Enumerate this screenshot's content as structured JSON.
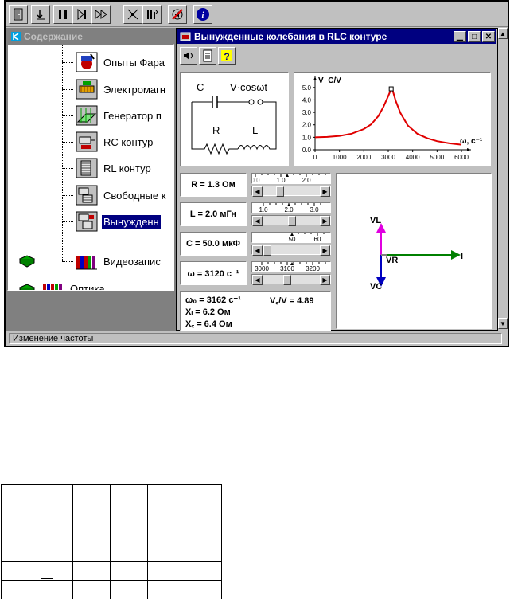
{
  "tree": {
    "title": "Содержание",
    "items": [
      {
        "label": "Опыты Фара",
        "icon": "faraday-experiments-icon"
      },
      {
        "label": "Электромагн",
        "icon": "electromagnet-icon"
      },
      {
        "label": "Генератор п",
        "icon": "generator-icon"
      },
      {
        "label": "RC контур",
        "icon": "rc-circuit-icon"
      },
      {
        "label": "RL контур",
        "icon": "rl-circuit-icon"
      },
      {
        "label": "Свободные к",
        "icon": "free-oscillations-icon"
      },
      {
        "label": "Вынужденн",
        "icon": "forced-oscillations-icon",
        "selected": true
      },
      {
        "label": "Видеозапис",
        "icon": "video-recordings-icon"
      }
    ],
    "bottom_item": {
      "label": "Оптика",
      "icon": "optics-icon"
    }
  },
  "child_window": {
    "title": "Вынужденные колебания в RLC контуре"
  },
  "circuit": {
    "c_label": "C",
    "v_label": "V·cosωt",
    "r_label": "R",
    "l_label": "L"
  },
  "params": [
    {
      "label": "R = 1.3 Ом",
      "scale_ticks": [
        "0.0",
        "1.0",
        "2.0"
      ],
      "thumb_position": 0.28
    },
    {
      "label": "L = 2.0 мГн",
      "scale_ticks": [
        "1.0",
        "2.0",
        "3.0"
      ],
      "thumb_position": 0.52
    },
    {
      "label": "C = 50.0 мкФ",
      "scale_ticks": [
        "50",
        "60"
      ],
      "thumb_position": 0.02
    },
    {
      "label": "ω = 3120 с⁻¹",
      "scale_ticks": [
        "3000",
        "3100",
        "3200"
      ],
      "thumb_position": 0.42
    }
  ],
  "readout": {
    "omega0": "ω₀ = 3162 с⁻¹",
    "vc_ratio": "V꜀/V = 4.89",
    "xl": "Xₗ = 6.2 Ом",
    "xc": "X꜀ = 6.4 Ом"
  },
  "vector_diagram": {
    "vl_label": "VL",
    "vr_label": "VR",
    "vc_label": "VC",
    "i_label": "I",
    "colors": {
      "vl": "#e000e0",
      "vc": "#0000c0",
      "i": "#008000"
    }
  },
  "chart_data": {
    "type": "line",
    "title": "",
    "ylabel": "V_C/V",
    "xlabel": "ω, с⁻¹",
    "x_ticks": [
      "0",
      "1000",
      "2000",
      "3000",
      "4000",
      "5000",
      "6000"
    ],
    "y_ticks": [
      "0.0",
      "1.0",
      "2.0",
      "3.0",
      "4.0",
      "5.0"
    ],
    "xlim": [
      0,
      6000
    ],
    "ylim": [
      0,
      5.5
    ],
    "series": [
      {
        "color": "#e00000",
        "x": [
          0,
          500,
          1000,
          1500,
          2000,
          2300,
          2600,
          2800,
          3000,
          3120,
          3162,
          3300,
          3500,
          3800,
          4200,
          4600,
          5000,
          5500,
          6000
        ],
        "y": [
          1.0,
          1.03,
          1.11,
          1.29,
          1.66,
          2.04,
          2.72,
          3.44,
          4.32,
          4.89,
          4.88,
          3.95,
          2.95,
          1.95,
          1.27,
          0.92,
          0.69,
          0.52,
          0.41
        ]
      }
    ],
    "marker": {
      "x": 3120,
      "y": 4.89
    }
  },
  "status": {
    "text": "Изменение частоты"
  }
}
